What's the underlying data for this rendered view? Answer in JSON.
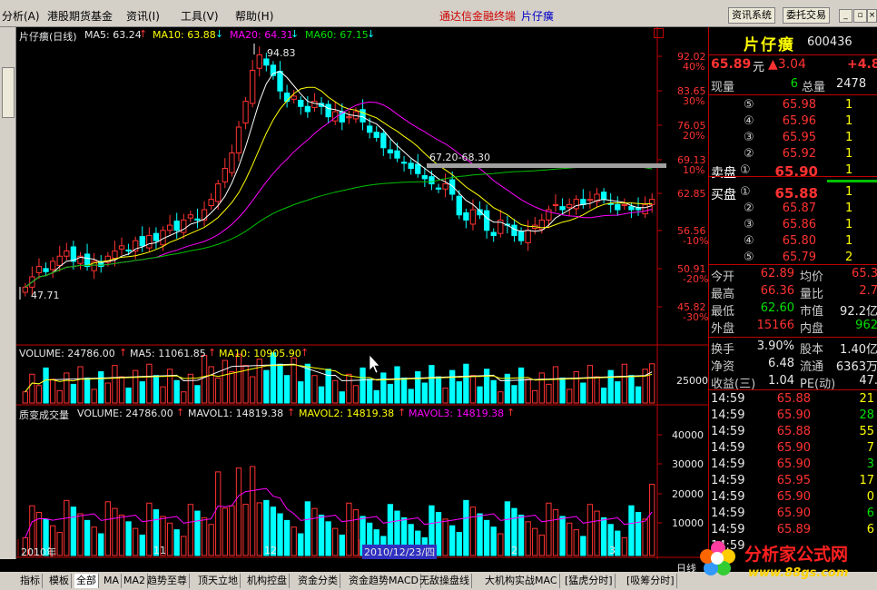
{
  "menubar": {
    "items": [
      "分析(A)",
      "港股期货基金",
      "资讯(I)",
      "工具(V)",
      "帮助(H)"
    ],
    "title": "通达信金融终端",
    "stock": "片仔癀",
    "buttons": [
      "资讯系统",
      "委托交易"
    ]
  },
  "main_chart": {
    "header": {
      "name": "片仔癀(日线)",
      "ma5": "MA5: 63.24",
      "ma10": "MA10: 63.88",
      "ma20": "MA20: 64.31",
      "ma60": "MA60: 67.15"
    },
    "price_axis": [
      {
        "price": "92.02",
        "pct": "40%"
      },
      {
        "price": "83.65",
        "pct": "30%"
      },
      {
        "price": "76.05",
        "pct": "20%"
      },
      {
        "price": "69.13",
        "pct": "10%"
      },
      {
        "price": "62.85",
        "pct": ""
      },
      {
        "price": "56.56",
        "pct": "-10%"
      },
      {
        "price": "50.91",
        "pct": "-20%"
      },
      {
        "price": "45.82",
        "pct": "-30%"
      }
    ],
    "annotations": {
      "high": "94.83",
      "low": "47.71",
      "band": "67.20-68.30"
    },
    "colors": {
      "up": "#ff3232",
      "down": "#00ffff",
      "ma5": "#ffffff",
      "ma10": "#ffff00",
      "ma20": "#ff00ff",
      "ma60": "#00c000",
      "grid": "#c00000"
    }
  },
  "volume_chart": {
    "header": {
      "volume": "VOLUME: 24786.00",
      "ma5": "MA5: 11061.85",
      "ma10": "MA10: 10905.90"
    },
    "axis": [
      "25000"
    ]
  },
  "indicator_chart": {
    "header": {
      "name": "质变成交量",
      "volume": "VOLUME: 24786.00",
      "mavol1": "MAVOL1: 14819.38",
      "mavol2": "MAVOL2: 14819.38",
      "mavol3": "MAVOL3: 14819.38"
    },
    "axis": [
      "40000",
      "30000",
      "20000",
      "10000"
    ],
    "dates": [
      "2010年",
      "11",
      "12",
      "2010/12/23/四",
      "2",
      "3"
    ],
    "period": "日线"
  },
  "quote": {
    "name": "片仔癀",
    "code": "600436",
    "price": "65.89",
    "unit": "元",
    "change": "▲3.04",
    "change_pct": "+4.8",
    "now_vol_label": "现量",
    "now_vol": "6",
    "total_vol_label": "总量",
    "total_vol": "2478",
    "asks": [
      {
        "lvl": "⑤",
        "price": "65.98",
        "vol": "1"
      },
      {
        "lvl": "④",
        "price": "65.96",
        "vol": "1"
      },
      {
        "lvl": "③",
        "price": "65.95",
        "vol": "1"
      },
      {
        "lvl": "②",
        "price": "65.92",
        "vol": "1"
      },
      {
        "lvl": "①",
        "price": "65.90",
        "vol": "1"
      }
    ],
    "ask_label": "卖盘",
    "bid_label": "买盘",
    "bids": [
      {
        "lvl": "①",
        "price": "65.88",
        "vol": "1"
      },
      {
        "lvl": "②",
        "price": "65.87",
        "vol": "1"
      },
      {
        "lvl": "③",
        "price": "65.86",
        "vol": "1"
      },
      {
        "lvl": "④",
        "price": "65.80",
        "vol": "1"
      },
      {
        "lvl": "⑤",
        "price": "65.79",
        "vol": "2"
      }
    ],
    "stats": [
      {
        "l1": "今开",
        "v1": "62.89",
        "l2": "均价",
        "v2": "65.3"
      },
      {
        "l1": "最高",
        "v1": "66.36",
        "l2": "量比",
        "v2": "2.7"
      },
      {
        "l1": "最低",
        "v1": "62.60",
        "l2": "市值",
        "v2": "92.2亿"
      },
      {
        "l1": "外盘",
        "v1": "15166",
        "l2": "内盘",
        "v2": "962"
      }
    ],
    "stats2": [
      {
        "l1": "换手",
        "v1": "3.90%",
        "l2": "股本",
        "v2": "1.40亿"
      },
      {
        "l1": "净资",
        "v1": "6.48",
        "l2": "流通",
        "v2": "6363万"
      },
      {
        "l1": "收益(三)",
        "v1": "1.04",
        "l2": "PE(动)",
        "v2": "47."
      }
    ],
    "ticks": [
      {
        "time": "14:59",
        "price": "65.88",
        "vol": "21"
      },
      {
        "time": "14:59",
        "price": "65.90",
        "vol": "28"
      },
      {
        "time": "14:59",
        "price": "65.88",
        "vol": "55"
      },
      {
        "time": "14:59",
        "price": "65.90",
        "vol": "7"
      },
      {
        "time": "14:59",
        "price": "65.90",
        "vol": "3"
      },
      {
        "time": "14:59",
        "price": "65.95",
        "vol": "17"
      },
      {
        "time": "14:59",
        "price": "65.90",
        "vol": "0"
      },
      {
        "time": "14:59",
        "price": "65.90",
        "vol": "6"
      },
      {
        "time": "14:59",
        "price": "65.89",
        "vol": "6"
      },
      {
        "time": "14:59",
        "price": "",
        "vol": ""
      }
    ]
  },
  "tabs": [
    "指标",
    "模板",
    "全部",
    "MA",
    "MA2",
    "趋势至尊",
    "顶天立地",
    "机构控盘",
    "资金分类",
    "资金趋势MACD",
    "无敌操盘线",
    "大机构实战MAC",
    "[猛虎分时]",
    "[吸筹分时]"
  ],
  "watermark": {
    "text": "分析家公式网",
    "url": "www.88gs.com"
  }
}
